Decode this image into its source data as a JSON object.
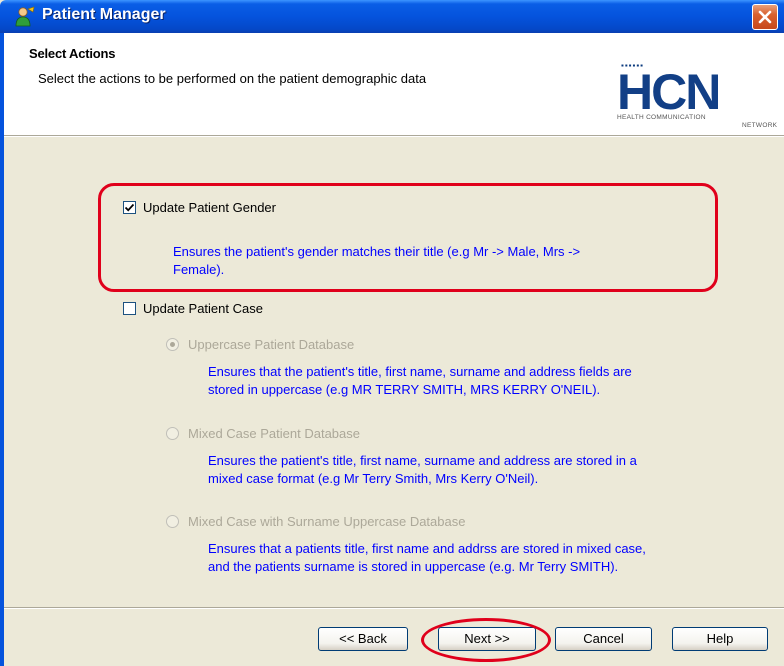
{
  "window": {
    "title": "Patient Manager",
    "icon": "patient-manager-icon"
  },
  "header": {
    "title": "Select Actions",
    "subtitle": "Select the actions to be performed on the patient demographic data",
    "logo": {
      "dots": "▪▪▪▪▪▪",
      "mark": "HCN",
      "tagline_1": "HEALTH COMMUNICATION",
      "tagline_2": "NETWORK"
    }
  },
  "options": {
    "update_gender": {
      "label": "Update Patient Gender",
      "checked": true,
      "desc_line1": "Ensures the patient's gender matches their title (e.g Mr -> Male, Mrs ->",
      "desc_line2": "Female)."
    },
    "update_case": {
      "label": "Update Patient Case",
      "checked": false,
      "choices": [
        {
          "label": "Uppercase Patient Database",
          "selected": true,
          "desc_line1": "Ensures that the patient's title, first name, surname and address fields are",
          "desc_line2": "stored in uppercase (e.g MR TERRY SMITH, MRS KERRY O'NEIL)."
        },
        {
          "label": "Mixed Case Patient Database",
          "selected": false,
          "desc_line1": "Ensures the patient's title, first name, surname and address are stored in a",
          "desc_line2": "mixed case format (e.g Mr Terry Smith, Mrs Kerry O'Neil)."
        },
        {
          "label": "Mixed Case with Surname Uppercase Database",
          "selected": false,
          "desc_line1": "Ensures that a patients title, first name and addrss are stored in mixed case,",
          "desc_line2": "and the patients surname is stored in uppercase (e.g. Mr Terry SMITH)."
        }
      ]
    }
  },
  "buttons": {
    "back": "<< Back",
    "next": "Next >>",
    "cancel": "Cancel",
    "help": "Help"
  },
  "colors": {
    "titlebar": "#0553dd",
    "description_text": "#0000ff",
    "annotation": "#e0001b",
    "disabled_text": "#aca899"
  }
}
